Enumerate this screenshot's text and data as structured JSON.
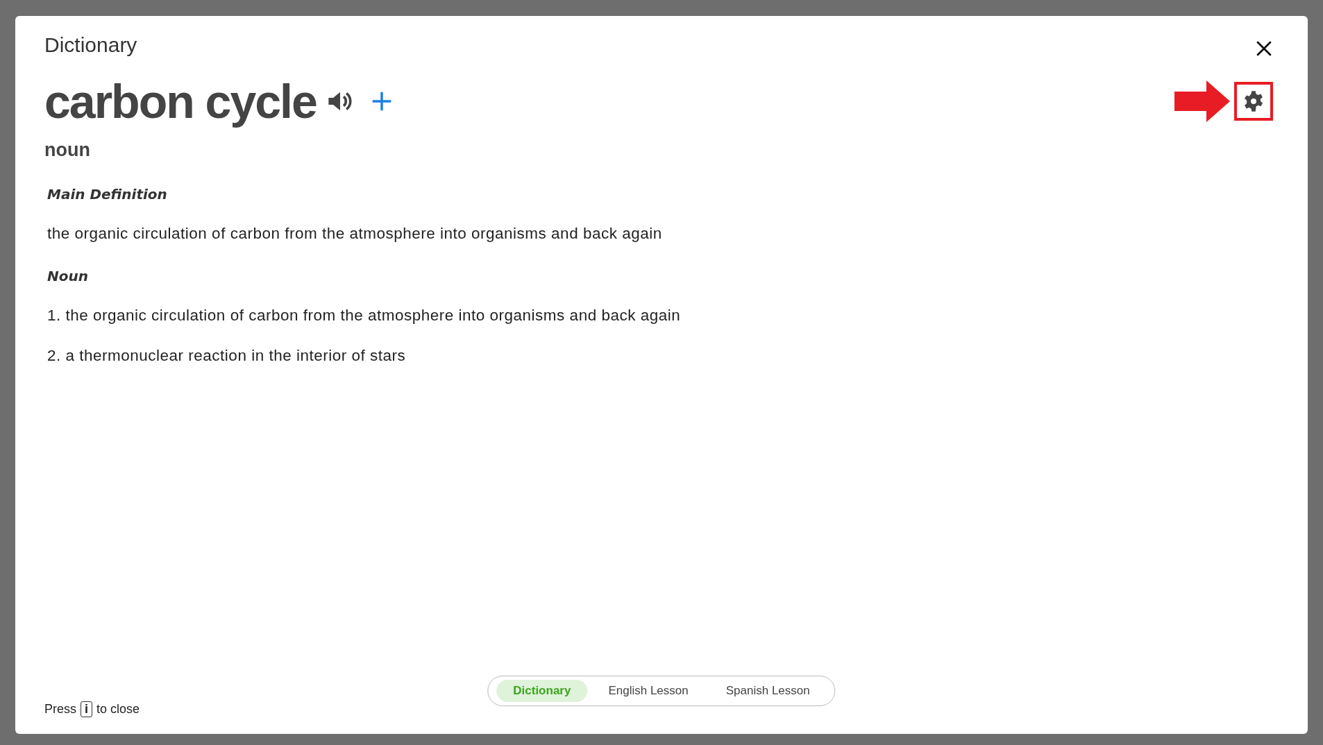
{
  "dialog": {
    "title": "Dictionary",
    "headword": "carbon cycle",
    "part_of_speech": "noun",
    "sections": [
      {
        "heading": "Main Definition",
        "lines": [
          "the organic circulation of carbon from the atmosphere into organisms and back again"
        ]
      },
      {
        "heading": "Noun",
        "lines": [
          "1. the organic circulation of carbon from the atmosphere into organisms and back again",
          "2. a thermonuclear reaction in the interior of stars"
        ]
      }
    ],
    "hint": {
      "before": "Press",
      "key": "i",
      "after": "to close"
    },
    "tabs": [
      {
        "label": "Dictionary",
        "selected": true
      },
      {
        "label": "English Lesson",
        "selected": false
      },
      {
        "label": "Spanish Lesson",
        "selected": false
      }
    ]
  }
}
